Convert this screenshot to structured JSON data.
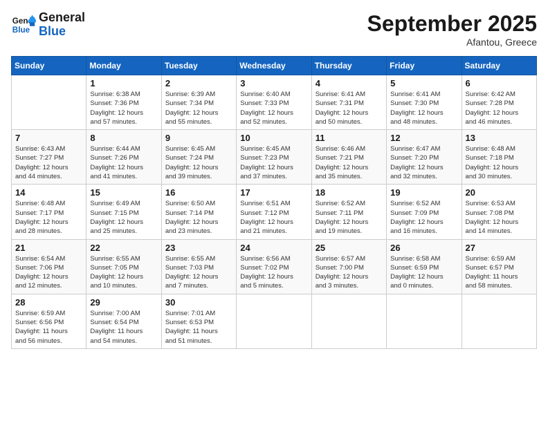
{
  "header": {
    "logo_line1": "General",
    "logo_line2": "Blue",
    "month": "September 2025",
    "location": "Afantou, Greece"
  },
  "weekdays": [
    "Sunday",
    "Monday",
    "Tuesday",
    "Wednesday",
    "Thursday",
    "Friday",
    "Saturday"
  ],
  "weeks": [
    [
      {
        "day": "",
        "info": ""
      },
      {
        "day": "1",
        "info": "Sunrise: 6:38 AM\nSunset: 7:36 PM\nDaylight: 12 hours\nand 57 minutes."
      },
      {
        "day": "2",
        "info": "Sunrise: 6:39 AM\nSunset: 7:34 PM\nDaylight: 12 hours\nand 55 minutes."
      },
      {
        "day": "3",
        "info": "Sunrise: 6:40 AM\nSunset: 7:33 PM\nDaylight: 12 hours\nand 52 minutes."
      },
      {
        "day": "4",
        "info": "Sunrise: 6:41 AM\nSunset: 7:31 PM\nDaylight: 12 hours\nand 50 minutes."
      },
      {
        "day": "5",
        "info": "Sunrise: 6:41 AM\nSunset: 7:30 PM\nDaylight: 12 hours\nand 48 minutes."
      },
      {
        "day": "6",
        "info": "Sunrise: 6:42 AM\nSunset: 7:28 PM\nDaylight: 12 hours\nand 46 minutes."
      }
    ],
    [
      {
        "day": "7",
        "info": "Sunrise: 6:43 AM\nSunset: 7:27 PM\nDaylight: 12 hours\nand 44 minutes."
      },
      {
        "day": "8",
        "info": "Sunrise: 6:44 AM\nSunset: 7:26 PM\nDaylight: 12 hours\nand 41 minutes."
      },
      {
        "day": "9",
        "info": "Sunrise: 6:45 AM\nSunset: 7:24 PM\nDaylight: 12 hours\nand 39 minutes."
      },
      {
        "day": "10",
        "info": "Sunrise: 6:45 AM\nSunset: 7:23 PM\nDaylight: 12 hours\nand 37 minutes."
      },
      {
        "day": "11",
        "info": "Sunrise: 6:46 AM\nSunset: 7:21 PM\nDaylight: 12 hours\nand 35 minutes."
      },
      {
        "day": "12",
        "info": "Sunrise: 6:47 AM\nSunset: 7:20 PM\nDaylight: 12 hours\nand 32 minutes."
      },
      {
        "day": "13",
        "info": "Sunrise: 6:48 AM\nSunset: 7:18 PM\nDaylight: 12 hours\nand 30 minutes."
      }
    ],
    [
      {
        "day": "14",
        "info": "Sunrise: 6:48 AM\nSunset: 7:17 PM\nDaylight: 12 hours\nand 28 minutes."
      },
      {
        "day": "15",
        "info": "Sunrise: 6:49 AM\nSunset: 7:15 PM\nDaylight: 12 hours\nand 25 minutes."
      },
      {
        "day": "16",
        "info": "Sunrise: 6:50 AM\nSunset: 7:14 PM\nDaylight: 12 hours\nand 23 minutes."
      },
      {
        "day": "17",
        "info": "Sunrise: 6:51 AM\nSunset: 7:12 PM\nDaylight: 12 hours\nand 21 minutes."
      },
      {
        "day": "18",
        "info": "Sunrise: 6:52 AM\nSunset: 7:11 PM\nDaylight: 12 hours\nand 19 minutes."
      },
      {
        "day": "19",
        "info": "Sunrise: 6:52 AM\nSunset: 7:09 PM\nDaylight: 12 hours\nand 16 minutes."
      },
      {
        "day": "20",
        "info": "Sunrise: 6:53 AM\nSunset: 7:08 PM\nDaylight: 12 hours\nand 14 minutes."
      }
    ],
    [
      {
        "day": "21",
        "info": "Sunrise: 6:54 AM\nSunset: 7:06 PM\nDaylight: 12 hours\nand 12 minutes."
      },
      {
        "day": "22",
        "info": "Sunrise: 6:55 AM\nSunset: 7:05 PM\nDaylight: 12 hours\nand 10 minutes."
      },
      {
        "day": "23",
        "info": "Sunrise: 6:55 AM\nSunset: 7:03 PM\nDaylight: 12 hours\nand 7 minutes."
      },
      {
        "day": "24",
        "info": "Sunrise: 6:56 AM\nSunset: 7:02 PM\nDaylight: 12 hours\nand 5 minutes."
      },
      {
        "day": "25",
        "info": "Sunrise: 6:57 AM\nSunset: 7:00 PM\nDaylight: 12 hours\nand 3 minutes."
      },
      {
        "day": "26",
        "info": "Sunrise: 6:58 AM\nSunset: 6:59 PM\nDaylight: 12 hours\nand 0 minutes."
      },
      {
        "day": "27",
        "info": "Sunrise: 6:59 AM\nSunset: 6:57 PM\nDaylight: 11 hours\nand 58 minutes."
      }
    ],
    [
      {
        "day": "28",
        "info": "Sunrise: 6:59 AM\nSunset: 6:56 PM\nDaylight: 11 hours\nand 56 minutes."
      },
      {
        "day": "29",
        "info": "Sunrise: 7:00 AM\nSunset: 6:54 PM\nDaylight: 11 hours\nand 54 minutes."
      },
      {
        "day": "30",
        "info": "Sunrise: 7:01 AM\nSunset: 6:53 PM\nDaylight: 11 hours\nand 51 minutes."
      },
      {
        "day": "",
        "info": ""
      },
      {
        "day": "",
        "info": ""
      },
      {
        "day": "",
        "info": ""
      },
      {
        "day": "",
        "info": ""
      }
    ]
  ]
}
